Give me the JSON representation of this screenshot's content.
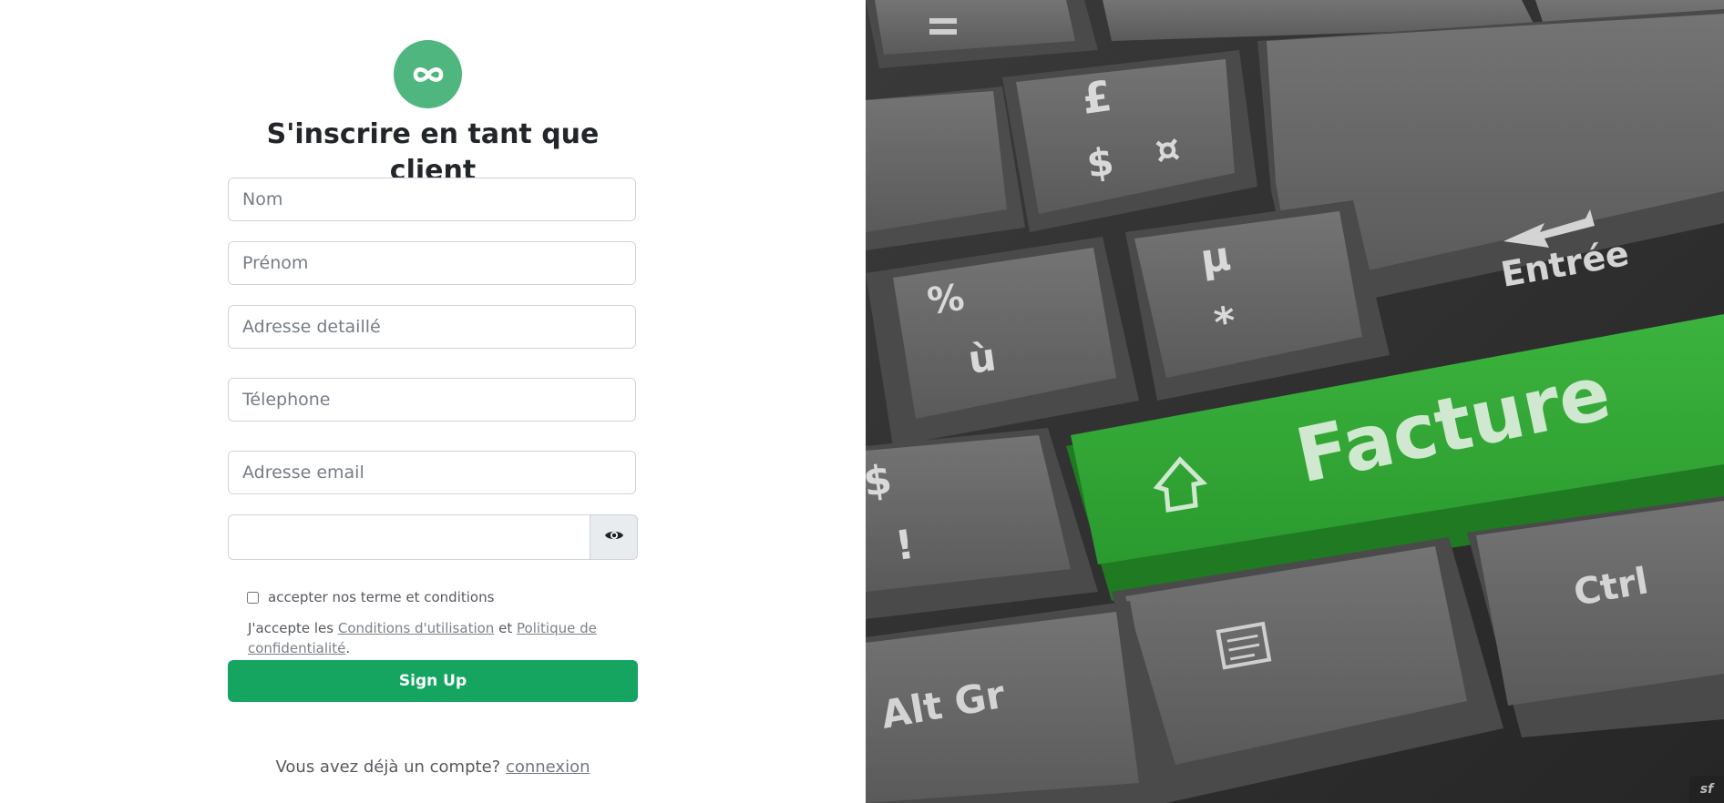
{
  "form": {
    "title": "S'inscrire en tant que client",
    "nom_placeholder": "Nom",
    "prenom_placeholder": "Prénom",
    "adresse_placeholder": "Adresse detaillé",
    "telephone_placeholder": "Télephone",
    "email_placeholder": "Adresse email",
    "password_value": "",
    "terms_label": "accepter nos terme et conditions",
    "legal_prefix": "J'accepte les",
    "legal_cgu_link": "Conditions d'utilisation",
    "legal_and": "et",
    "legal_privacy_link": "Politique de confidentialité",
    "legal_suffix": ".",
    "signup_label": "Sign Up",
    "login_prompt": "Vous avez déjà un compte?",
    "login_link": "connexion"
  },
  "keyboard_image": {
    "keys": {
      "pound": "£",
      "dollar": "$",
      "currency": "¤",
      "mu": "μ",
      "star": "*",
      "percent": "%",
      "u_grave": "ù",
      "entree": "Entrée",
      "facture": "Facture",
      "ctrl": "Ctrl",
      "altgr": "Alt Gr",
      "excl": "!",
      "dollar_left": "$"
    }
  },
  "footer": {
    "sf_badge": "sf"
  },
  "colors": {
    "logo_bg": "#4fb67f",
    "button_bg": "#16a561",
    "facture_key": "#2ea836"
  },
  "icons": {
    "logo": "infinity-icon",
    "password_toggle": "eye-icon"
  }
}
